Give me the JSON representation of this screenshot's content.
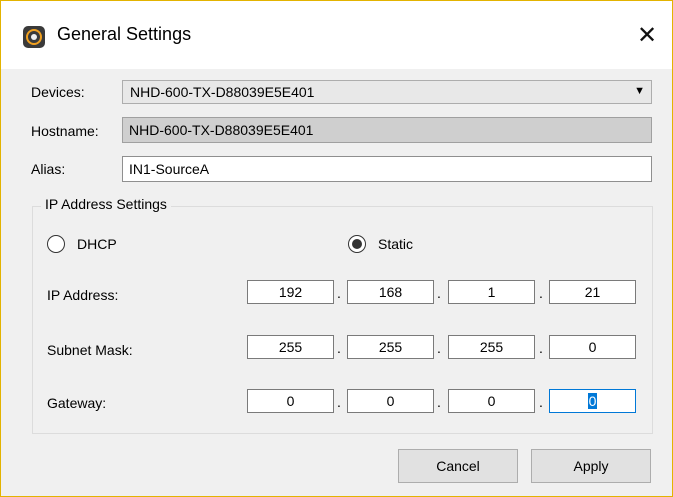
{
  "window": {
    "title": "General Settings",
    "icon": "nhd-app-icon",
    "close_glyph": "✕"
  },
  "form": {
    "devices_label": "Devices:",
    "devices_value": "NHD-600-TX-D88039E5E401",
    "hostname_label": "Hostname:",
    "hostname_value": "NHD-600-TX-D88039E5E401",
    "alias_label": "Alias:",
    "alias_value": "IN1-SourceA"
  },
  "ip_settings": {
    "group_title": "IP Address Settings",
    "dhcp_label": "DHCP",
    "static_label": "Static",
    "selected_mode": "Static",
    "ip_label": "IP Address:",
    "ip": [
      "192",
      "168",
      "1",
      "21"
    ],
    "subnet_label": "Subnet Mask:",
    "subnet": [
      "255",
      "255",
      "255",
      "0"
    ],
    "gateway_label": "Gateway:",
    "gateway": [
      "0",
      "0",
      "0",
      "0"
    ]
  },
  "buttons": {
    "cancel": "Cancel",
    "apply": "Apply"
  }
}
